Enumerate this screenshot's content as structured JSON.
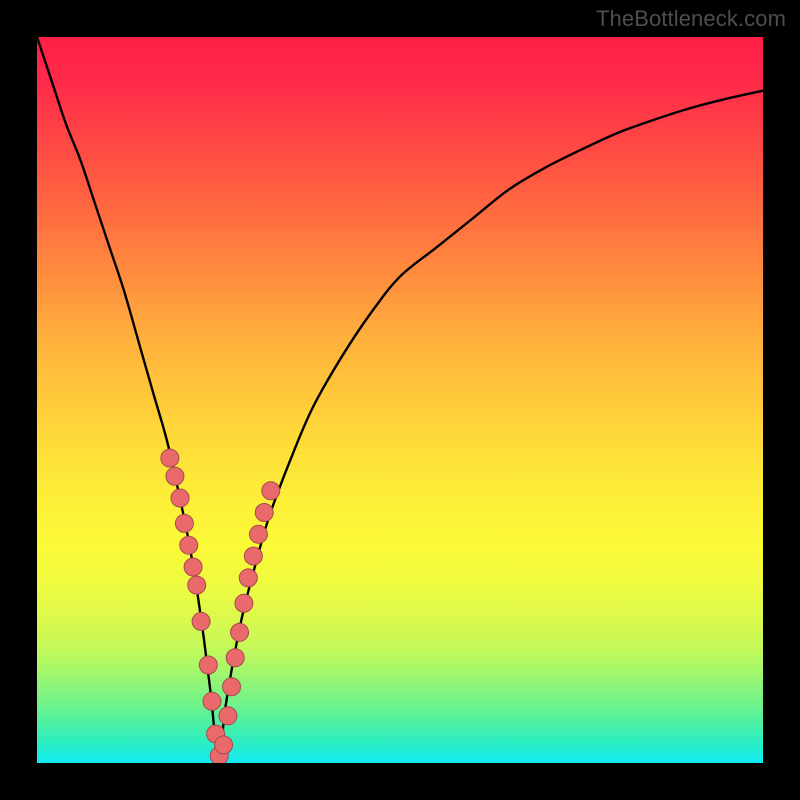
{
  "watermark": {
    "text": "TheBottleneck.com"
  },
  "colors": {
    "frame": "#000000",
    "curve": "#000000",
    "dot_fill": "#ea6a6c",
    "dot_stroke": "#a34b4d"
  },
  "chart_data": {
    "type": "line",
    "title": "",
    "subtitle": "",
    "xlabel": "",
    "ylabel": "",
    "xlim": [
      0,
      100
    ],
    "ylim": [
      0,
      100
    ],
    "grid": false,
    "legend": null,
    "annotations": [],
    "series": [
      {
        "name": "bottleneck-curve",
        "x": [
          0,
          2,
          4,
          6,
          8,
          10,
          12,
          14,
          16,
          18,
          20,
          21,
          22,
          23,
          24,
          25,
          26,
          28,
          30,
          32,
          35,
          38,
          42,
          46,
          50,
          55,
          60,
          65,
          70,
          75,
          80,
          85,
          90,
          95,
          100
        ],
        "y": [
          100,
          94,
          88,
          83,
          77,
          71,
          65,
          58,
          51,
          44,
          35,
          30,
          24,
          17,
          9,
          0,
          8,
          19,
          27,
          34,
          42,
          49,
          56,
          62,
          67,
          71,
          75,
          79,
          82,
          84.5,
          86.8,
          88.6,
          90.2,
          91.5,
          92.6
        ]
      }
    ],
    "scatter_overlay": {
      "name": "sample-points",
      "points": [
        {
          "x": 18.3,
          "y": 42
        },
        {
          "x": 19.0,
          "y": 39.5
        },
        {
          "x": 19.7,
          "y": 36.5
        },
        {
          "x": 20.3,
          "y": 33
        },
        {
          "x": 20.9,
          "y": 30
        },
        {
          "x": 21.5,
          "y": 27
        },
        {
          "x": 22.0,
          "y": 24.5
        },
        {
          "x": 22.6,
          "y": 19.5
        },
        {
          "x": 23.6,
          "y": 13.5
        },
        {
          "x": 24.1,
          "y": 8.5
        },
        {
          "x": 24.6,
          "y": 4
        },
        {
          "x": 25.1,
          "y": 1
        },
        {
          "x": 25.7,
          "y": 2.5
        },
        {
          "x": 26.3,
          "y": 6.5
        },
        {
          "x": 26.8,
          "y": 10.5
        },
        {
          "x": 27.3,
          "y": 14.5
        },
        {
          "x": 27.9,
          "y": 18
        },
        {
          "x": 28.5,
          "y": 22
        },
        {
          "x": 29.1,
          "y": 25.5
        },
        {
          "x": 29.8,
          "y": 28.5
        },
        {
          "x": 30.5,
          "y": 31.5
        },
        {
          "x": 31.3,
          "y": 34.5
        },
        {
          "x": 32.2,
          "y": 37.5
        }
      ]
    },
    "background_gradient_stops": [
      {
        "pct": 0,
        "hex": "#ff1f46"
      },
      {
        "pct": 18,
        "hex": "#ff5342"
      },
      {
        "pct": 42,
        "hex": "#ffb13c"
      },
      {
        "pct": 70,
        "hex": "#fbfa38"
      },
      {
        "pct": 92,
        "hex": "#6ff38a"
      },
      {
        "pct": 100,
        "hex": "#0feaf5"
      }
    ]
  }
}
